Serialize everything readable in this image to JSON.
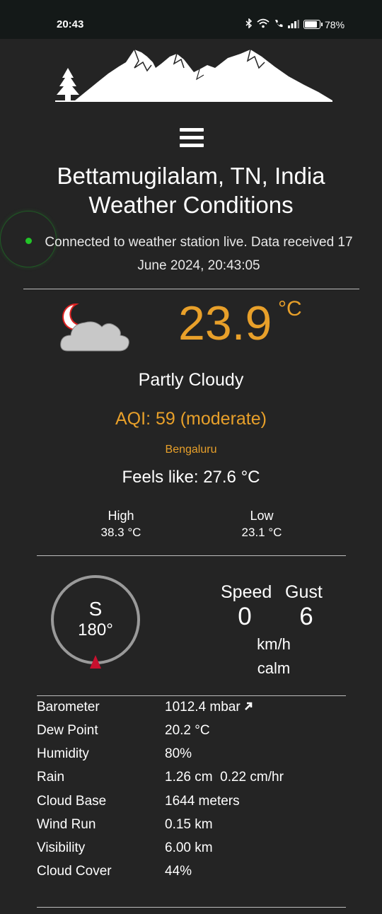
{
  "status_bar": {
    "time": "20:43",
    "battery": "78%"
  },
  "header": {
    "title_line1": "Bettamugilalam, TN, India",
    "title_line2": "Weather Conditions",
    "connection_text": "Connected to weather station live. Data received 17 June 2024, 20:43:05"
  },
  "current": {
    "icon": "partly-cloudy-night-icon",
    "temperature": "23.9",
    "temp_unit": "°C",
    "condition": "Partly Cloudy",
    "aqi": "AQI: 59 (moderate)",
    "aqi_location": "Bengaluru",
    "feels_like": "Feels like: 27.6 °C",
    "high_label": "High",
    "high_value": "38.3 °C",
    "low_label": "Low",
    "low_value": "23.1 °C"
  },
  "wind": {
    "direction": "S",
    "degrees": "180°",
    "speed_label": "Speed",
    "gust_label": "Gust",
    "speed": "0",
    "gust": "6",
    "unit": "km/h",
    "description": "calm"
  },
  "details": [
    {
      "label": "Barometer",
      "value": "1012.4 mbar",
      "trend_icon": "arrow-up-right-icon"
    },
    {
      "label": "Dew Point",
      "value": "20.2 °C"
    },
    {
      "label": "Humidity",
      "value": "80%"
    },
    {
      "label": "Rain",
      "value": "1.26 cm  0.22 cm/hr"
    },
    {
      "label": "Cloud Base",
      "value": "1644 meters"
    },
    {
      "label": "Wind Run",
      "value": "0.15 km"
    },
    {
      "label": "Visibility",
      "value": "6.00 km"
    },
    {
      "label": "Cloud Cover",
      "value": "44%"
    }
  ],
  "colors": {
    "accent": "#e8a02a",
    "background": "#242424",
    "live": "#22c428",
    "compass_pointer": "#c8102e"
  }
}
